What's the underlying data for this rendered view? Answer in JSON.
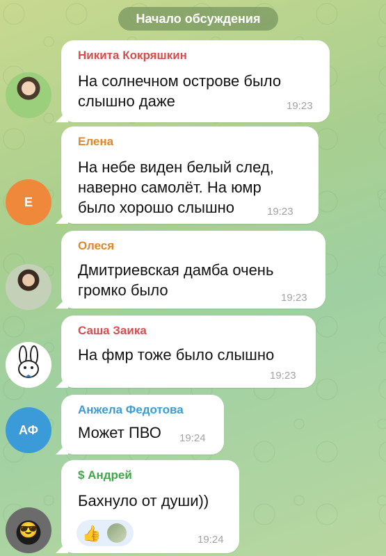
{
  "system": {
    "discussion_start": "Начало обсуждения"
  },
  "messages": [
    {
      "author": "Никита Кокряшкин",
      "author_color": "#d94c4c",
      "text": "На солнечном острове было\nслышно даже",
      "time": "19:23",
      "avatar": {
        "type": "photo"
      }
    },
    {
      "author": "Елена",
      "author_color": "#e0862f",
      "text": "На небе виден белый след,\nнаверно самолёт. На юмр\nбыло хорошо слышно",
      "time": "19:23",
      "avatar": {
        "type": "initials",
        "initials": "Е",
        "color": "#f0883c"
      }
    },
    {
      "author": "Олеся",
      "author_color": "#e0862f",
      "text": "Дмитриевская дамба очень\nгромко было",
      "time": "19:23",
      "avatar": {
        "type": "photo"
      }
    },
    {
      "author": "Саша Заика",
      "author_color": "#d94c4c",
      "text": "На фмр тоже было слышно",
      "time": "19:23",
      "avatar": {
        "type": "bunny"
      }
    },
    {
      "author": "Анжела Федотова",
      "author_color": "#3a9bd8",
      "text": "Может ПВО",
      "time": "19:24",
      "avatar": {
        "type": "initials",
        "initials": "АФ",
        "color": "#3a9bd8"
      }
    },
    {
      "author": "$ Андрей",
      "author_color": "#3fa64a",
      "text": "Бахнуло от души))",
      "time": "19:24",
      "avatar": {
        "type": "photo"
      },
      "reactions": {
        "emoji": "👍"
      }
    }
  ],
  "colors": {
    "bubble": "#ffffff",
    "time": "#a2a2a2"
  }
}
